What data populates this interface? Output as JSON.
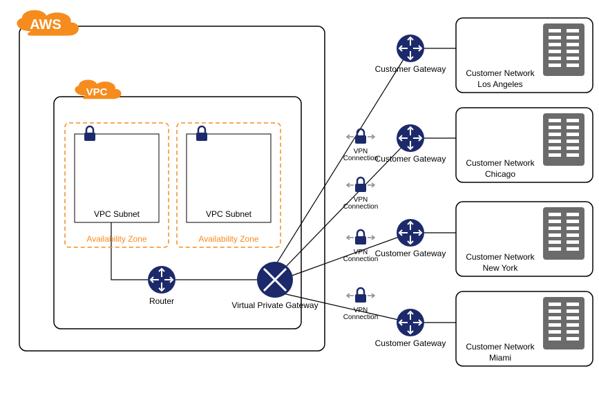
{
  "cloud": {
    "aws_label": "AWS",
    "vpc_label": "VPC"
  },
  "subnets": [
    {
      "label": "VPC Subnet",
      "zone": "Availability Zone"
    },
    {
      "label": "VPC Subnet",
      "zone": "Availability Zone"
    }
  ],
  "router": {
    "label": "Router"
  },
  "vpg": {
    "label": "Virtual Private Gateway"
  },
  "vpn": [
    {
      "label_top": "VPN",
      "label_bottom": "Connection"
    },
    {
      "label_top": "VPN",
      "label_bottom": "Connection"
    },
    {
      "label_top": "VPN",
      "label_bottom": "Connection"
    },
    {
      "label_top": "VPN",
      "label_bottom": "Connection"
    }
  ],
  "gateways": [
    {
      "label": "Customer Gateway"
    },
    {
      "label": "Customer Gateway"
    },
    {
      "label": "Customer Gateway"
    },
    {
      "label": "Customer Gateway"
    }
  ],
  "networks": [
    {
      "line1": "Customer Network",
      "line2": "Los Angeles"
    },
    {
      "line1": "Customer Network",
      "line2": "Chicago"
    },
    {
      "line1": "Customer Network",
      "line2": "New York"
    },
    {
      "line1": "Customer Network",
      "line2": "Miami"
    }
  ]
}
